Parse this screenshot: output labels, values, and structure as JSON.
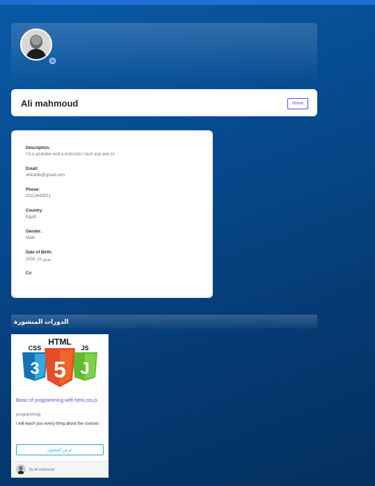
{
  "profile": {
    "name": "Ali mahmoud",
    "home_label": "Home"
  },
  "info": {
    "fields": [
      {
        "label": "Description:",
        "value": "i'm a youtuber and a instructor i tech asp and c#"
      },
      {
        "label": "Email:",
        "value": "Alikok8h@gmail.com"
      },
      {
        "label": "Phone:",
        "value": "01112643021"
      },
      {
        "label": "Country:",
        "value": "Egypt"
      },
      {
        "label": "Gender:",
        "value": "Male"
      },
      {
        "label": "Date of Birth:",
        "value": "يونيو 21, 2003"
      },
      {
        "label": "Cv:",
        "value": ""
      }
    ]
  },
  "courses_section": {
    "title": "الدورات المنشورة"
  },
  "course": {
    "thumb_text": {
      "top": "HTML",
      "left": "CSS",
      "right": "JS"
    },
    "title": "Basic of programming with html,css,js",
    "category": "programming",
    "description": "i will teach you every thing about the courses",
    "view_label": "عرض المحتوى",
    "author": "By Ali mahmoud"
  },
  "colors": {
    "accent": "#5a4fd6",
    "button_info": "#2aa9cf",
    "html5": "#e44d26",
    "css3": "#1572b6",
    "js": "#5fbb2f"
  }
}
